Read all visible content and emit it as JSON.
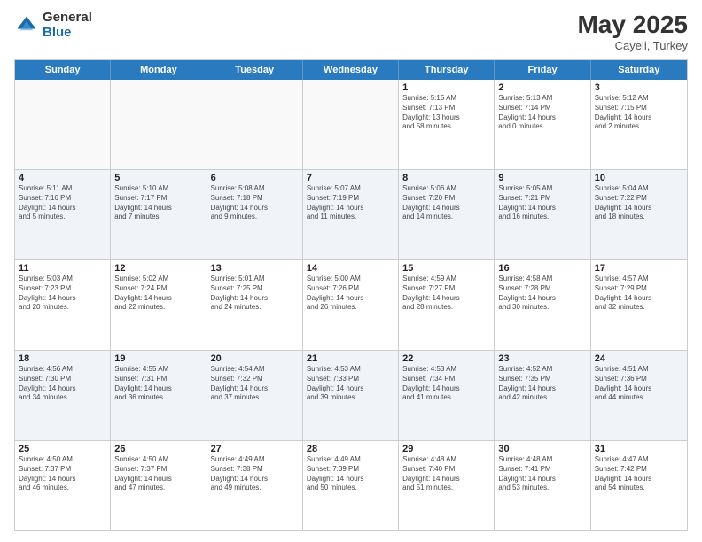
{
  "header": {
    "logo_general": "General",
    "logo_blue": "Blue",
    "title": "May 2025",
    "location": "Cayeli, Turkey"
  },
  "calendar": {
    "days_of_week": [
      "Sunday",
      "Monday",
      "Tuesday",
      "Wednesday",
      "Thursday",
      "Friday",
      "Saturday"
    ],
    "rows": [
      [
        {
          "day": "",
          "info": "",
          "empty": true
        },
        {
          "day": "",
          "info": "",
          "empty": true
        },
        {
          "day": "",
          "info": "",
          "empty": true
        },
        {
          "day": "",
          "info": "",
          "empty": true
        },
        {
          "day": "1",
          "info": "Sunrise: 5:15 AM\nSunset: 7:13 PM\nDaylight: 13 hours\nand 58 minutes."
        },
        {
          "day": "2",
          "info": "Sunrise: 5:13 AM\nSunset: 7:14 PM\nDaylight: 14 hours\nand 0 minutes."
        },
        {
          "day": "3",
          "info": "Sunrise: 5:12 AM\nSunset: 7:15 PM\nDaylight: 14 hours\nand 2 minutes."
        }
      ],
      [
        {
          "day": "4",
          "info": "Sunrise: 5:11 AM\nSunset: 7:16 PM\nDaylight: 14 hours\nand 5 minutes."
        },
        {
          "day": "5",
          "info": "Sunrise: 5:10 AM\nSunset: 7:17 PM\nDaylight: 14 hours\nand 7 minutes."
        },
        {
          "day": "6",
          "info": "Sunrise: 5:08 AM\nSunset: 7:18 PM\nDaylight: 14 hours\nand 9 minutes."
        },
        {
          "day": "7",
          "info": "Sunrise: 5:07 AM\nSunset: 7:19 PM\nDaylight: 14 hours\nand 11 minutes."
        },
        {
          "day": "8",
          "info": "Sunrise: 5:06 AM\nSunset: 7:20 PM\nDaylight: 14 hours\nand 14 minutes."
        },
        {
          "day": "9",
          "info": "Sunrise: 5:05 AM\nSunset: 7:21 PM\nDaylight: 14 hours\nand 16 minutes."
        },
        {
          "day": "10",
          "info": "Sunrise: 5:04 AM\nSunset: 7:22 PM\nDaylight: 14 hours\nand 18 minutes."
        }
      ],
      [
        {
          "day": "11",
          "info": "Sunrise: 5:03 AM\nSunset: 7:23 PM\nDaylight: 14 hours\nand 20 minutes."
        },
        {
          "day": "12",
          "info": "Sunrise: 5:02 AM\nSunset: 7:24 PM\nDaylight: 14 hours\nand 22 minutes."
        },
        {
          "day": "13",
          "info": "Sunrise: 5:01 AM\nSunset: 7:25 PM\nDaylight: 14 hours\nand 24 minutes."
        },
        {
          "day": "14",
          "info": "Sunrise: 5:00 AM\nSunset: 7:26 PM\nDaylight: 14 hours\nand 26 minutes."
        },
        {
          "day": "15",
          "info": "Sunrise: 4:59 AM\nSunset: 7:27 PM\nDaylight: 14 hours\nand 28 minutes."
        },
        {
          "day": "16",
          "info": "Sunrise: 4:58 AM\nSunset: 7:28 PM\nDaylight: 14 hours\nand 30 minutes."
        },
        {
          "day": "17",
          "info": "Sunrise: 4:57 AM\nSunset: 7:29 PM\nDaylight: 14 hours\nand 32 minutes."
        }
      ],
      [
        {
          "day": "18",
          "info": "Sunrise: 4:56 AM\nSunset: 7:30 PM\nDaylight: 14 hours\nand 34 minutes."
        },
        {
          "day": "19",
          "info": "Sunrise: 4:55 AM\nSunset: 7:31 PM\nDaylight: 14 hours\nand 36 minutes."
        },
        {
          "day": "20",
          "info": "Sunrise: 4:54 AM\nSunset: 7:32 PM\nDaylight: 14 hours\nand 37 minutes."
        },
        {
          "day": "21",
          "info": "Sunrise: 4:53 AM\nSunset: 7:33 PM\nDaylight: 14 hours\nand 39 minutes."
        },
        {
          "day": "22",
          "info": "Sunrise: 4:53 AM\nSunset: 7:34 PM\nDaylight: 14 hours\nand 41 minutes."
        },
        {
          "day": "23",
          "info": "Sunrise: 4:52 AM\nSunset: 7:35 PM\nDaylight: 14 hours\nand 42 minutes."
        },
        {
          "day": "24",
          "info": "Sunrise: 4:51 AM\nSunset: 7:36 PM\nDaylight: 14 hours\nand 44 minutes."
        }
      ],
      [
        {
          "day": "25",
          "info": "Sunrise: 4:50 AM\nSunset: 7:37 PM\nDaylight: 14 hours\nand 46 minutes."
        },
        {
          "day": "26",
          "info": "Sunrise: 4:50 AM\nSunset: 7:37 PM\nDaylight: 14 hours\nand 47 minutes."
        },
        {
          "day": "27",
          "info": "Sunrise: 4:49 AM\nSunset: 7:38 PM\nDaylight: 14 hours\nand 49 minutes."
        },
        {
          "day": "28",
          "info": "Sunrise: 4:49 AM\nSunset: 7:39 PM\nDaylight: 14 hours\nand 50 minutes."
        },
        {
          "day": "29",
          "info": "Sunrise: 4:48 AM\nSunset: 7:40 PM\nDaylight: 14 hours\nand 51 minutes."
        },
        {
          "day": "30",
          "info": "Sunrise: 4:48 AM\nSunset: 7:41 PM\nDaylight: 14 hours\nand 53 minutes."
        },
        {
          "day": "31",
          "info": "Sunrise: 4:47 AM\nSunset: 7:42 PM\nDaylight: 14 hours\nand 54 minutes."
        }
      ]
    ]
  }
}
